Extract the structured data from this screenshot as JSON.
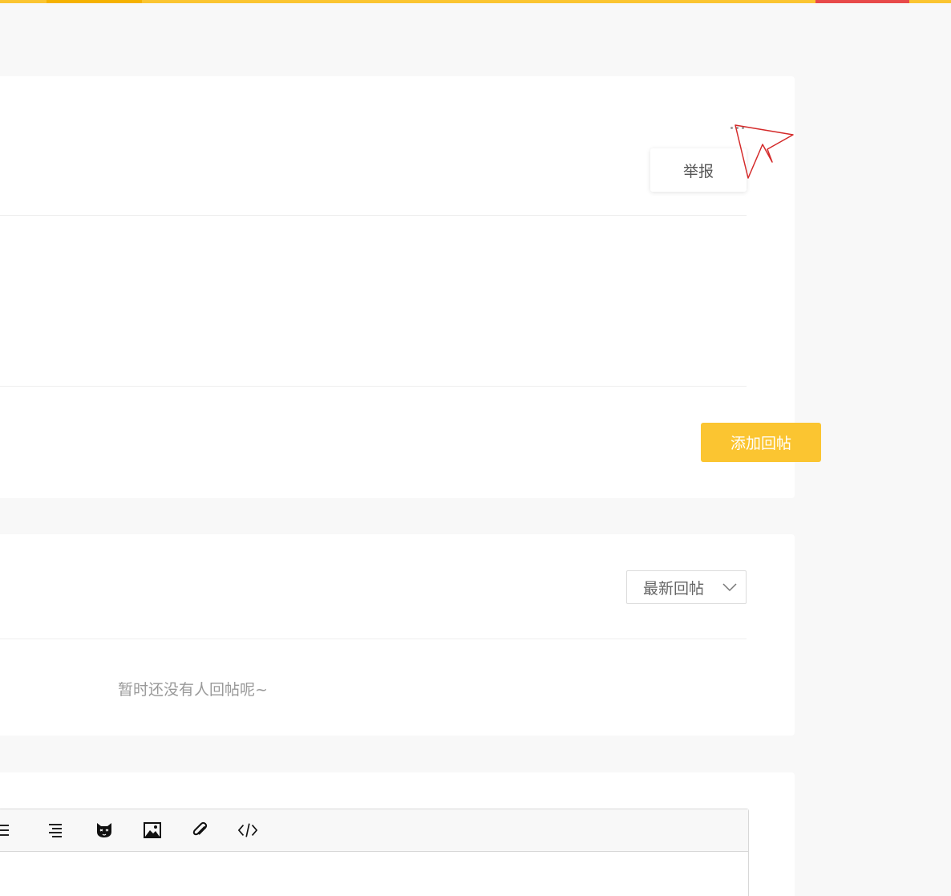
{
  "post_menu": {
    "report_label": "举报"
  },
  "actions": {
    "add_reply_label": "添加回帖"
  },
  "replies": {
    "sort_selected": "最新回帖",
    "empty_message": "暂时还没有人回帖呢~"
  },
  "editor": {
    "toolbar": [
      {
        "name": "align-center-icon"
      },
      {
        "name": "align-right-icon"
      },
      {
        "name": "emoji-cat-icon"
      },
      {
        "name": "image-icon"
      },
      {
        "name": "attachment-icon"
      },
      {
        "name": "code-icon"
      }
    ]
  },
  "colors": {
    "accent": "#fbc531",
    "accent_dark": "#f5b200",
    "danger": "#e84a4a"
  }
}
